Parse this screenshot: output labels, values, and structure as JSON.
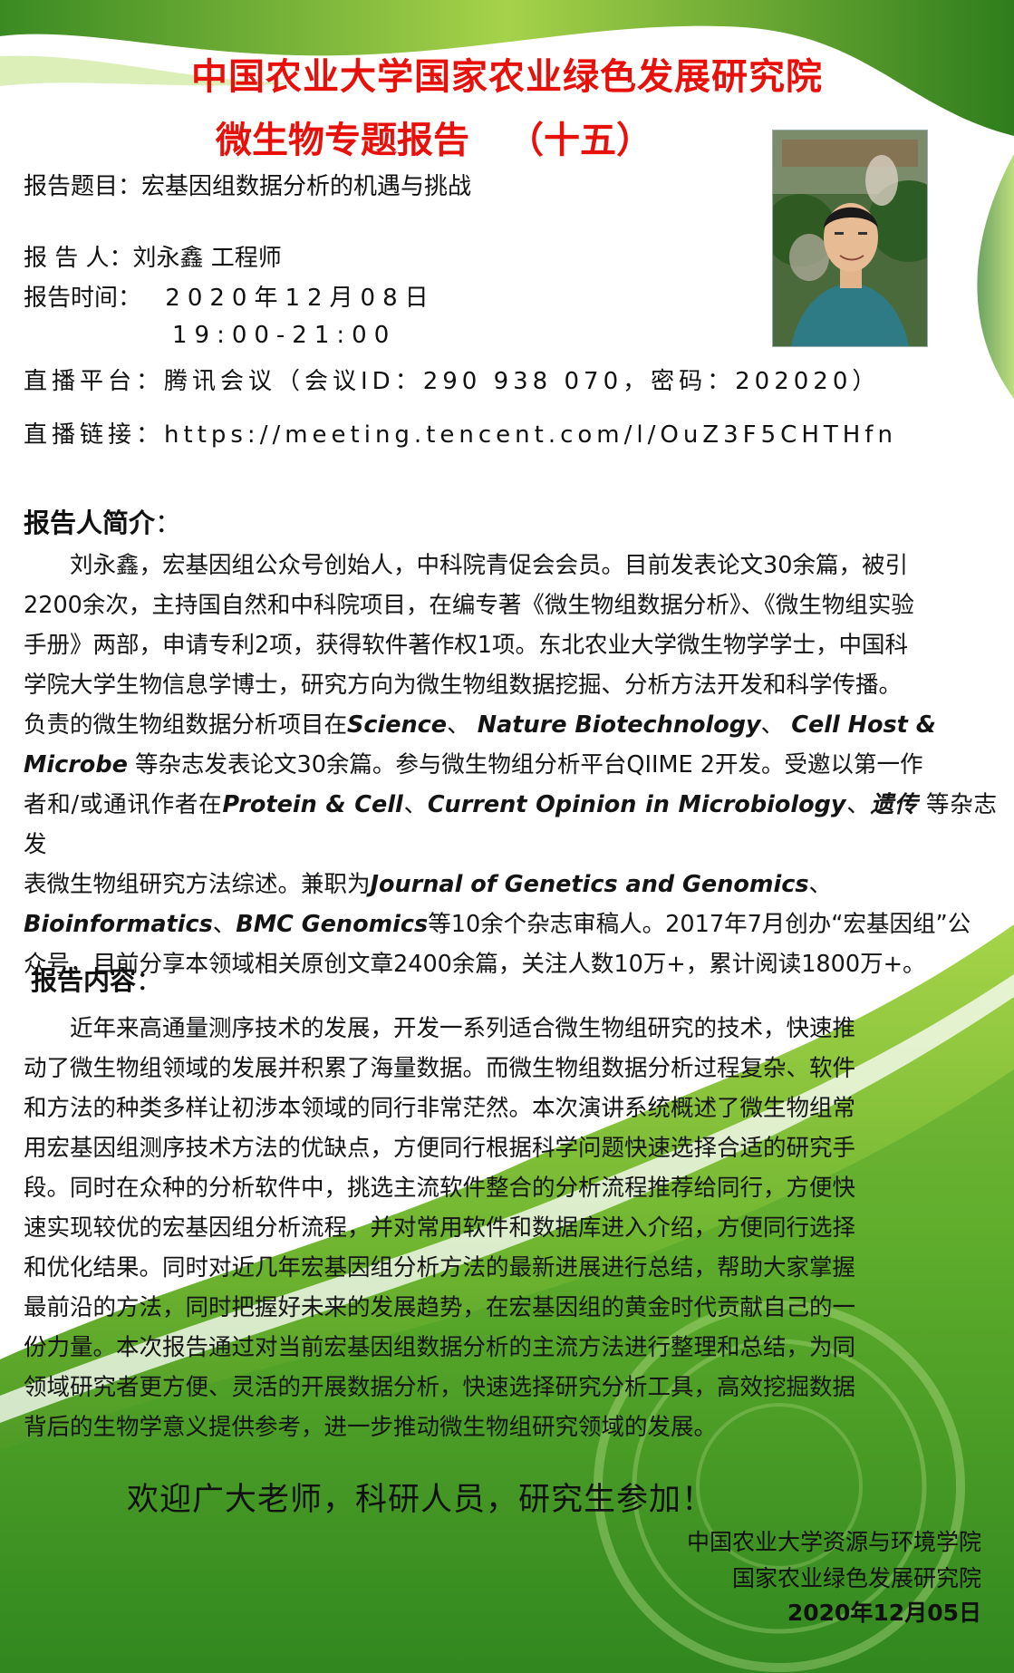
{
  "header": {
    "title_line1": "中国农业大学国家农业绿色发展研究院",
    "title_line2": "微生物专题报告",
    "title_number": "（十五）"
  },
  "details": {
    "topic_label": "报告题目：",
    "topic": "宏基因组数据分析的机遇与挑战",
    "speaker_label": "报 告 人：",
    "speaker": "刘永鑫 工程师",
    "time_label": "报告时间：",
    "date": "2020年12月08日",
    "hours": "19:00-21:00",
    "platform_label": "直播平台：",
    "platform": "腾讯会议（会议ID：290 938 070，密码：202020）",
    "link_label": "直播链接：",
    "link": "https://meeting.tencent.com/l/OuZ3F5CHTHfn"
  },
  "bio": {
    "heading": "报告人简介",
    "heading_colon": "：",
    "lines": [
      "　　刘永鑫，宏基因组公众号创始人，中科院青促会会员。目前发表论文30余篇，被引",
      "2200余次，主持国自然和中科院项目，在编专著《微生物组数据分析》、《微生物组实验",
      "手册》两部，申请专利2项，获得软件著作权1项。东北农业大学微生物学学士，中国科",
      "学院大学生物信息学博士，研究方向为微生物组数据挖掘、分析方法开发和科学传播。",
      "负责的微生物组数据分析项目在",
      "、",
      "、",
      "等杂志发表论文30余篇。参与微生物组分析平台QIIME 2开发。受邀以第一作",
      "者和/或通讯作者在",
      "、",
      "、",
      "等杂志发",
      "表微生物组研究方法综述。兼职为",
      "、",
      "、",
      "等10余个杂志审稿人。2017年7月创办“宏基因组”公",
      "众号，目前分享本领域相关原创文章2400余篇，关注人数10万+，累计阅读1800万+。"
    ],
    "journals": {
      "science": "Science",
      "nature_biotech": "Nature Biotechnology",
      "cell_host_microbe": "Cell Host & Microbe",
      "protein_cell": "Protein & Cell",
      "curr_opin": "Current Opinion in Microbiology",
      "yichuan": "遗传",
      "jgg": "Journal of Genetics and Genomics",
      "bioinformatics": "Bioinformatics",
      "bmc_genomics": "BMC Genomics"
    }
  },
  "content": {
    "heading": "报告内容",
    "heading_colon": "：",
    "lines": [
      "　　近年来高通量测序技术的发展，开发一系列适合微生物组研究的技术，快速推",
      "动了微生物组领域的发展并积累了海量数据。而微生物组数据分析过程复杂、软件",
      "和方法的种类多样让初涉本领域的同行非常茫然。本次演讲系统概述了微生物组常",
      "用宏基因组测序技术方法的优缺点，方便同行根据科学问题快速选择合适的研究手",
      "段。同时在众种的分析软件中，挑选主流软件整合的分析流程推荐给同行，方便快",
      "速实现较优的宏基因组分析流程，并对常用软件和数据库进入介绍，方便同行选择",
      "和优化结果。同时对近几年宏基因组分析方法的最新进展进行总结，帮助大家掌握",
      "最前沿的方法，同时把握好未来的发展趋势，在宏基因组的黄金时代贡献自己的一",
      "份力量。本次报告通过对当前宏基因组数据分析的主流方法进行整理和总结，为同",
      "领域研究者更方便、灵活的开展数据分析，快速选择研究分析工具，高效挖掘数据",
      "背后的生物学意义提供参考，进一步推动微生物组研究领域的发展。"
    ]
  },
  "welcome": "欢迎广大老师，科研人员，研究生参加！",
  "footer": {
    "org1": "中国农业大学资源与环境学院",
    "org2": "国家农业绿色发展研究院",
    "date": "2020年12月05日"
  },
  "colors": {
    "title_red": "#e8100a",
    "green_dark": "#2f7a1e",
    "green_light": "#8cc63f"
  }
}
